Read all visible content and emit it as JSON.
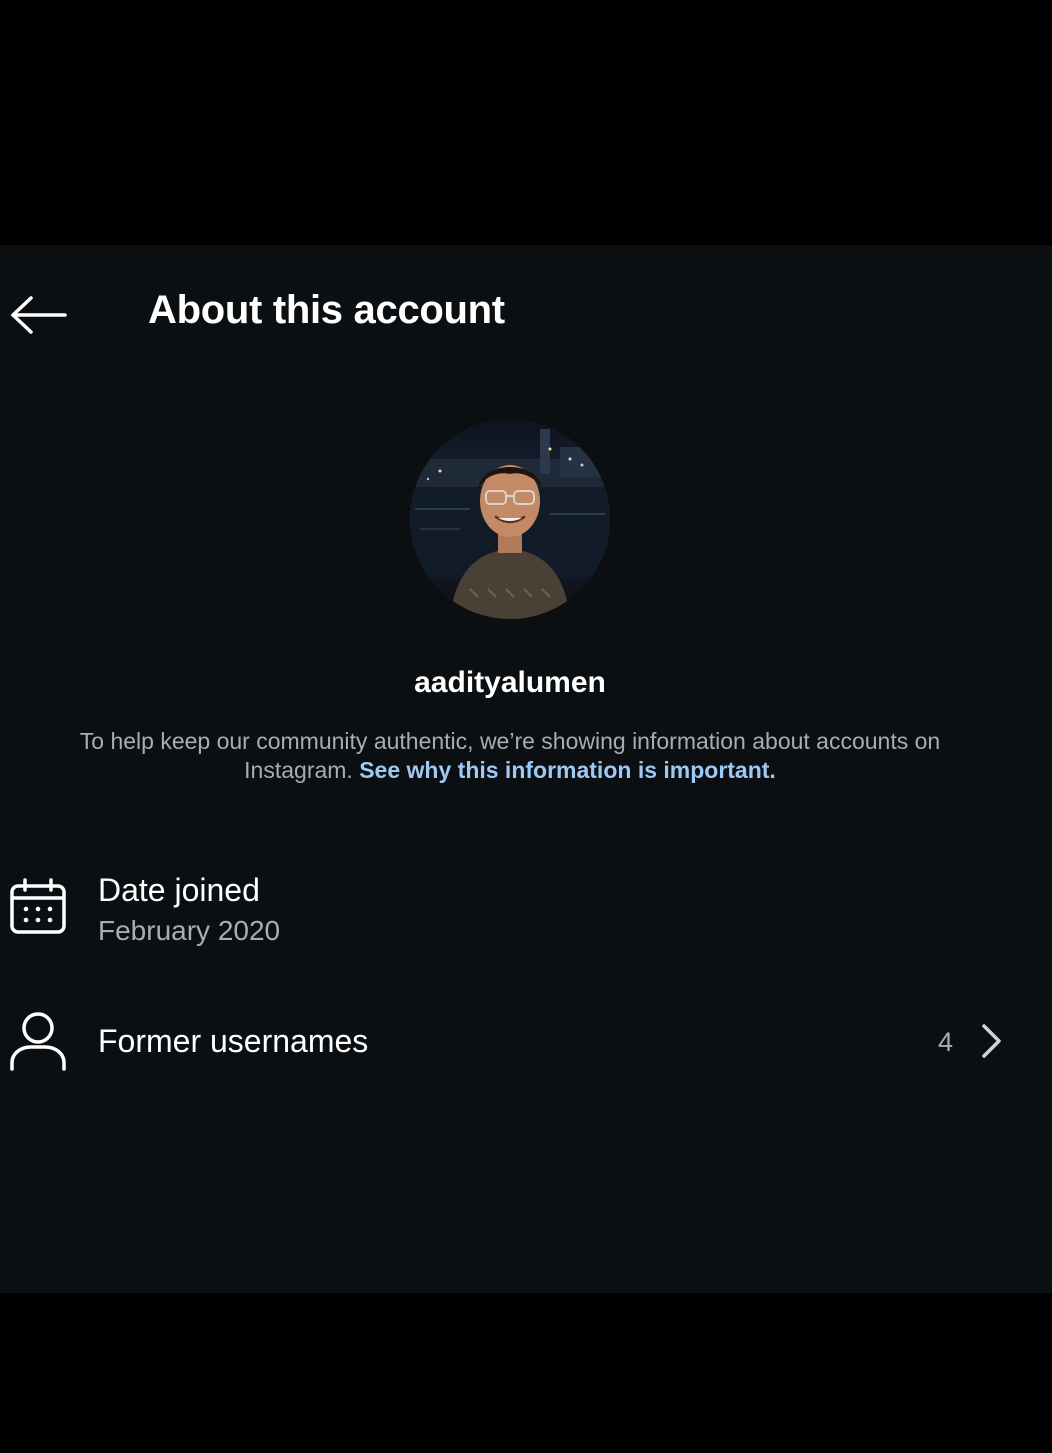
{
  "header": {
    "back_icon": "arrow-left-icon",
    "title": "About this account"
  },
  "profile": {
    "avatar_alt": "profile-photo",
    "username": "aadityalumen"
  },
  "info": {
    "text": "To help keep our community authentic, we’re showing information about accounts on Instagram. ",
    "link": "See why this information is important."
  },
  "details": {
    "date_joined": {
      "icon": "calendar-icon",
      "label": "Date joined",
      "value": "February 2020"
    },
    "former_usernames": {
      "icon": "person-icon",
      "label": "Former usernames",
      "count": "4",
      "chevron_icon": "chevron-right-icon"
    }
  },
  "colors": {
    "background": "#0b0f12",
    "outer": "#000000",
    "text_primary": "#ffffff",
    "text_secondary": "#a8adb3",
    "link": "#9ec9f5"
  }
}
